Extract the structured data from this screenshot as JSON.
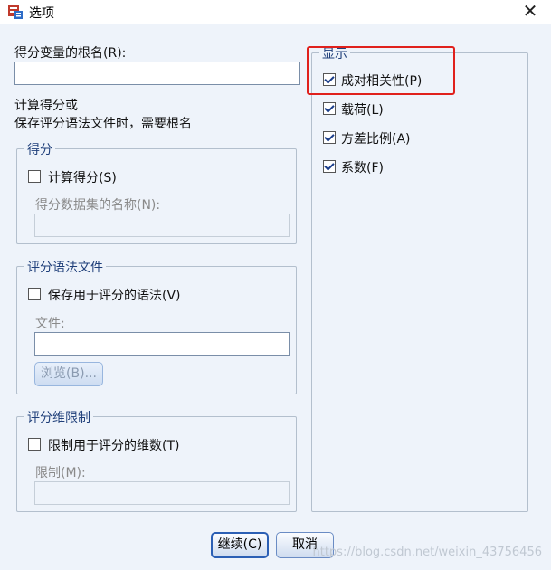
{
  "window": {
    "title": "选项"
  },
  "root_name": {
    "label": "得分变量的根名(R):",
    "value": "",
    "hint_line1": "计算得分或",
    "hint_line2": "保存评分语法文件时，需要根名"
  },
  "score_group": {
    "legend": "得分",
    "compute_label": "计算得分(S)",
    "compute_checked": false,
    "dataset_label": "得分数据集的名称(N):",
    "dataset_value": ""
  },
  "syntax_group": {
    "legend": "评分语法文件",
    "save_label": "保存用于评分的语法(V)",
    "save_checked": false,
    "file_label": "文件:",
    "file_value": "",
    "browse_label": "浏览(B)..."
  },
  "dim_group": {
    "legend": "评分维限制",
    "limit_label": "限制用于评分的维数(T)",
    "limit_checked": false,
    "max_label": "限制(M):",
    "max_value": ""
  },
  "display_group": {
    "legend": "显示",
    "items": [
      {
        "label": "成对相关性(P)",
        "checked": true
      },
      {
        "label": "载荷(L)",
        "checked": true
      },
      {
        "label": "方差比例(A)",
        "checked": true
      },
      {
        "label": "系数(F)",
        "checked": true
      }
    ]
  },
  "buttons": {
    "continue": "继续(C)",
    "cancel": "取消"
  },
  "watermark": "https://blog.csdn.net/weixin_43756456",
  "colors": {
    "highlight": "#e0201c",
    "background": "#eef3fa",
    "accent": "#2b5fb4"
  }
}
